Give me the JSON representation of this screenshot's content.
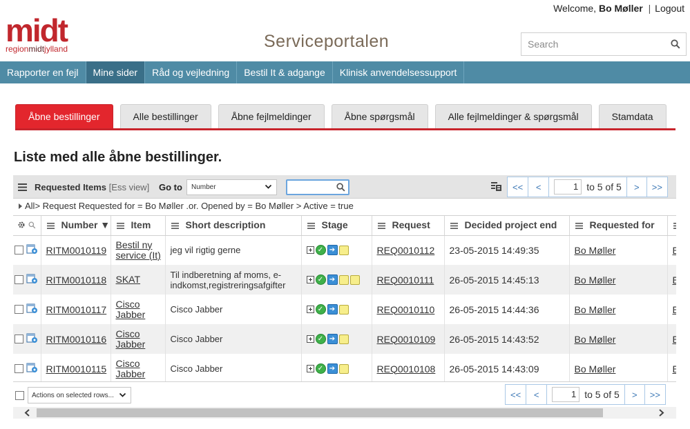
{
  "header": {
    "welcome_prefix": "Welcome,",
    "user_name": "Bo Møller",
    "separator": "|",
    "logout": "Logout",
    "logo_main": "midt",
    "logo_sub_a": "region",
    "logo_sub_b": "midt",
    "logo_sub_c": "jylland",
    "portal_title": "Serviceportalen",
    "search_placeholder": "Search",
    "brand_color": "#c1272d"
  },
  "nav": {
    "items": [
      {
        "label": "Rapporter en fejl"
      },
      {
        "label": "Mine sider"
      },
      {
        "label": "Råd og vejledning"
      },
      {
        "label": "Bestil It & adgange"
      },
      {
        "label": "Klinisk anvendelsessupport"
      }
    ],
    "active_index": 1,
    "bar_color": "#4f8ba5"
  },
  "tabs": {
    "items": [
      {
        "label": "Åbne bestillinger"
      },
      {
        "label": "Alle bestillinger"
      },
      {
        "label": "Åbne fejlmeldinger"
      },
      {
        "label": "Åbne spørgsmål"
      },
      {
        "label": "Alle fejlmeldinger & spørgsmål"
      },
      {
        "label": "Stamdata"
      }
    ],
    "active_index": 0,
    "active_color": "#e3262d"
  },
  "page": {
    "heading": "Liste med alle åbne bestillinger."
  },
  "list": {
    "title": "Requested Items",
    "view": "[Ess view]",
    "goto_label": "Go to",
    "goto_field": "Number",
    "goto_value": "",
    "breadcrumb": {
      "all": "All",
      "filter": "> Request Requested for = Bo Møller .or. Opened by = Bo Møller > Active = true"
    },
    "pager": {
      "first": "<<",
      "prev": "<",
      "page": "1",
      "range": "to 5 of 5",
      "next": ">",
      "last": ">>"
    },
    "columns": [
      {
        "label": "Number ▼"
      },
      {
        "label": "Item"
      },
      {
        "label": "Short description"
      },
      {
        "label": "Stage"
      },
      {
        "label": "Request"
      },
      {
        "label": "Decided project end"
      },
      {
        "label": "Requested for"
      },
      {
        "label": "E"
      }
    ],
    "rows": [
      {
        "number": "RITM0010119",
        "item": "Bestil ny service (It)",
        "desc": "jeg vil rigtig gerne",
        "stage_pending": 1,
        "request": "REQ0010112",
        "end": "23-05-2015 14:49:35",
        "req_for": "Bo Møller",
        "extra": "E"
      },
      {
        "number": "RITM0010118",
        "item": "SKAT",
        "desc": "Til indberetning af moms, e-indkomst,registreringsafgifter",
        "stage_pending": 2,
        "request": "REQ0010111",
        "end": "26-05-2015 14:45:13",
        "req_for": "Bo Møller",
        "extra": "E"
      },
      {
        "number": "RITM0010117",
        "item": "Cisco Jabber",
        "desc": "Cisco Jabber",
        "stage_pending": 1,
        "request": "REQ0010110",
        "end": "26-05-2015 14:44:36",
        "req_for": "Bo Møller",
        "extra": "E"
      },
      {
        "number": "RITM0010116",
        "item": "Cisco Jabber",
        "desc": "Cisco Jabber",
        "stage_pending": 1,
        "request": "REQ0010109",
        "end": "26-05-2015 14:43:52",
        "req_for": "Bo Møller",
        "extra": "E"
      },
      {
        "number": "RITM0010115",
        "item": "Cisco Jabber",
        "desc": "Cisco Jabber",
        "stage_pending": 1,
        "request": "REQ0010108",
        "end": "26-05-2015 14:43:09",
        "req_for": "Bo Møller",
        "extra": "E"
      }
    ],
    "actions_label": "Actions on selected rows..."
  }
}
